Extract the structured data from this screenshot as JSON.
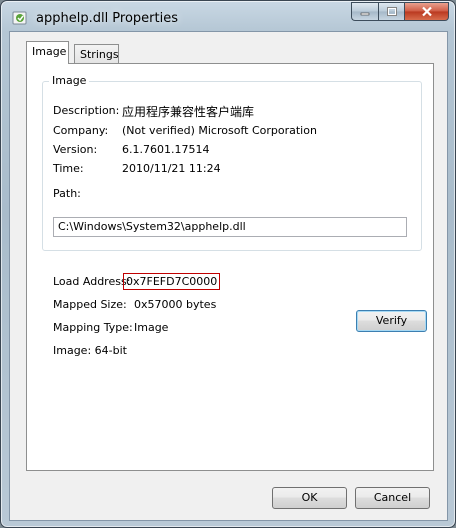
{
  "window": {
    "title": "apphelp.dll Properties",
    "app_icon": "application-icon",
    "controls": [
      "minimize-icon",
      "maximize-icon",
      "close-icon"
    ]
  },
  "tabs": [
    {
      "label": "Image",
      "active": true
    },
    {
      "label": "Strings",
      "active": false
    }
  ],
  "image_group": {
    "legend": "Image",
    "description_label": "Description:",
    "description_value": "应用程序兼容性客户端库",
    "company_label": "Company:",
    "company_value": "(Not verified) Microsoft Corporation",
    "version_label": "Version:",
    "version_value": "6.1.7601.17514",
    "time_label": "Time:",
    "time_value": "2010/11/21 11:24",
    "path_label": "Path:",
    "path_value": "C:\\Windows\\System32\\apphelp.dll"
  },
  "details": {
    "load_address_label": "Load Address:",
    "load_address_value": "0x7FEFD7C0000",
    "mapped_size_label": "Mapped Size:",
    "mapped_size_value": "0x57000 bytes",
    "mapping_type_label": "Mapping Type:",
    "mapping_type_value": "Image",
    "image_bits": "Image: 64-bit"
  },
  "buttons": {
    "verify": "Verify",
    "ok": "OK",
    "cancel": "Cancel"
  },
  "colors": {
    "highlight_border": "#c00000",
    "close_button": "#c9452b"
  }
}
